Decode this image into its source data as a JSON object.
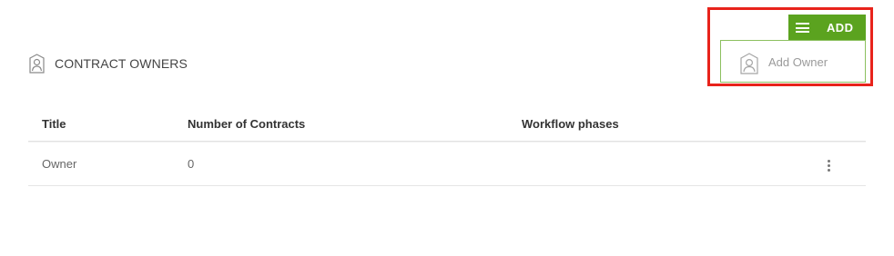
{
  "section": {
    "title": "CONTRACT OWNERS",
    "icon": "person-icon"
  },
  "table": {
    "columns": [
      "Title",
      "Number of Contracts",
      "Workflow phases"
    ],
    "rows": [
      {
        "title": "Owner",
        "contracts": "0",
        "phases": ""
      }
    ]
  },
  "toolbar": {
    "add_label": "ADD",
    "menu_icon": "hamburger-icon"
  },
  "dropdown": {
    "items": [
      {
        "label": "Add Owner",
        "icon": "person-icon"
      }
    ]
  },
  "colors": {
    "accent": "#5ba31f",
    "dropdown_border": "#8cc05f",
    "highlight": "#e8231b"
  }
}
